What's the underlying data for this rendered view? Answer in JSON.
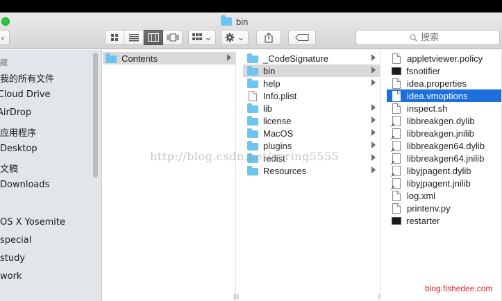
{
  "window": {
    "title": "bin"
  },
  "toolbar": {
    "back_glyph": "‹",
    "arrange_glyph": "⌄",
    "action_glyph": "⌄",
    "search_placeholder": "搜索"
  },
  "sidebar": {
    "header": "藏",
    "items": [
      "我的所有文件",
      "iCloud Drive",
      "AirDrop",
      "应用程序",
      "Desktop",
      "文稿",
      "Downloads"
    ],
    "devices": [
      "OS X Yosemite",
      "special",
      "study",
      "work"
    ]
  },
  "column1": [
    {
      "name": "Contents",
      "type": "folder",
      "selected": "gray",
      "arrow": true
    }
  ],
  "column2": [
    {
      "name": "_CodeSignature",
      "type": "folder",
      "arrow": true
    },
    {
      "name": "bin",
      "type": "folder",
      "selected": "gray",
      "arrow": true
    },
    {
      "name": "help",
      "type": "folder",
      "arrow": true
    },
    {
      "name": "Info.plist",
      "type": "doc"
    },
    {
      "name": "lib",
      "type": "folder",
      "arrow": true
    },
    {
      "name": "license",
      "type": "folder",
      "arrow": true
    },
    {
      "name": "MacOS",
      "type": "folder",
      "arrow": true
    },
    {
      "name": "plugins",
      "type": "folder",
      "arrow": true
    },
    {
      "name": "redist",
      "type": "folder",
      "arrow": true
    },
    {
      "name": "Resources",
      "type": "folder",
      "arrow": true
    }
  ],
  "column3": [
    {
      "name": "appletviewer.policy",
      "type": "doc"
    },
    {
      "name": "fsnotifier",
      "type": "exec"
    },
    {
      "name": "idea.properties",
      "type": "doc"
    },
    {
      "name": "idea.vmoptions",
      "type": "doc",
      "selected": "blue"
    },
    {
      "name": "inspect.sh",
      "type": "doc"
    },
    {
      "name": "libbreakgen.dylib",
      "type": "lib"
    },
    {
      "name": "libbreakgen.jnilib",
      "type": "lib"
    },
    {
      "name": "libbreakgen64.dylib",
      "type": "lib"
    },
    {
      "name": "libbreakgen64.jnilib",
      "type": "lib"
    },
    {
      "name": "libyjpagent.dylib",
      "type": "lib"
    },
    {
      "name": "libyjpagent.jnilib",
      "type": "lib"
    },
    {
      "name": "log.xml",
      "type": "doc"
    },
    {
      "name": "printenv.py",
      "type": "doc"
    },
    {
      "name": "restarter",
      "type": "exec"
    }
  ],
  "overlay": {
    "watermark": "http://blog.csdn.net/spring5555",
    "footer": "blog.fishedee.com"
  },
  "colors": {
    "selection_blue": "#1d6fdc",
    "folder": "#6fc3ef",
    "footer_text": "#e02020"
  }
}
